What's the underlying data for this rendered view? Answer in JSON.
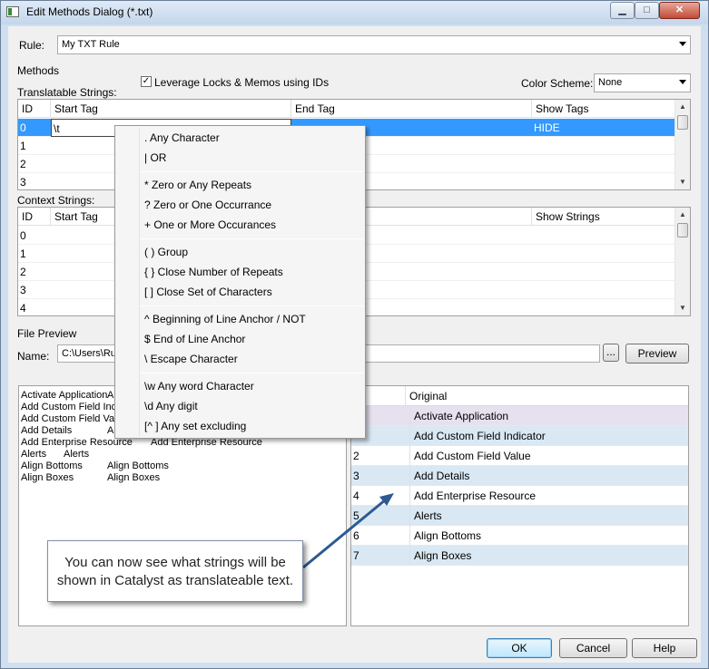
{
  "window": {
    "title": "Edit Methods Dialog (*.txt)",
    "minimize_label": "▁",
    "maximize_label": "□",
    "close_label": "✕"
  },
  "rule": {
    "label": "Rule:",
    "value": "My TXT Rule"
  },
  "methods": {
    "label": "Methods",
    "leverage_label": "Leverage Locks & Memos using IDs",
    "leverage_checked": true,
    "color_scheme_label": "Color Scheme:",
    "color_scheme_value": "None"
  },
  "translatable": {
    "label": "Translatable Strings:",
    "columns": [
      "ID",
      "Start Tag",
      "End Tag",
      "Show Tags"
    ],
    "rows": [
      {
        "id": "0",
        "start": "\\t",
        "end": "",
        "show": "HIDE"
      },
      {
        "id": "1",
        "start": "",
        "end": "",
        "show": ""
      },
      {
        "id": "2",
        "start": "",
        "end": "",
        "show": ""
      },
      {
        "id": "3",
        "start": "",
        "end": "",
        "show": ""
      }
    ]
  },
  "context": {
    "label": "Context Strings:",
    "columns": [
      "ID",
      "Start Tag",
      "Show Strings"
    ],
    "rows": [
      {
        "id": "0"
      },
      {
        "id": "1"
      },
      {
        "id": "2"
      },
      {
        "id": "3"
      },
      {
        "id": "4"
      }
    ]
  },
  "context_menu": {
    "items": [
      ".   Any Character",
      "|    OR",
      "*    Zero or Any Repeats",
      "?    Zero or One Occurrance",
      "+    One or More Occurances",
      "( )   Group",
      "{ }   Close Number of Repeats",
      "[ ]   Close Set of Characters",
      "^    Beginning of Line Anchor / NOT",
      "$    End of Line Anchor",
      "\\    Escape Character",
      "\\w   Any word Character",
      "\\d   Any digit",
      "[^ ]  Any set excluding"
    ]
  },
  "file_preview": {
    "label": "File Preview",
    "name_label": "Name:",
    "name_value": "C:\\Users\\Ru",
    "browse_label": "...",
    "preview_button": "Preview",
    "left_lines": [
      [
        "Activate Application",
        "A"
      ],
      [
        "Add Custom Field Indic",
        ""
      ],
      [
        "Add Custom Field Valu",
        ""
      ],
      [
        "Add Details",
        "A"
      ],
      [
        "Add Enterprise Resource",
        "Add Enterprise Resource"
      ],
      [
        "Alerts",
        "Alerts"
      ],
      [
        "Align Bottoms",
        "Align Bottoms"
      ],
      [
        "Align Boxes",
        "Align Boxes"
      ]
    ],
    "right_header": "Original",
    "right_rows": [
      {
        "id": "",
        "text": "Activate Application",
        "style": "lav"
      },
      {
        "id": "",
        "text": "Add Custom Field Indicator",
        "style": "blue"
      },
      {
        "id": "2",
        "text": "Add Custom Field Value",
        "style": ""
      },
      {
        "id": "3",
        "text": "Add Details",
        "style": "blue"
      },
      {
        "id": "4",
        "text": "Add Enterprise Resource",
        "style": ""
      },
      {
        "id": "5",
        "text": "Alerts",
        "style": "blue"
      },
      {
        "id": "6",
        "text": "Align Bottoms",
        "style": ""
      },
      {
        "id": "7",
        "text": "Align Boxes",
        "style": "blue"
      }
    ]
  },
  "callout": {
    "line1": "You can now see what strings will be",
    "line2": "shown in Catalyst as translateable text."
  },
  "buttons": {
    "ok": "OK",
    "cancel": "Cancel",
    "help": "Help"
  }
}
